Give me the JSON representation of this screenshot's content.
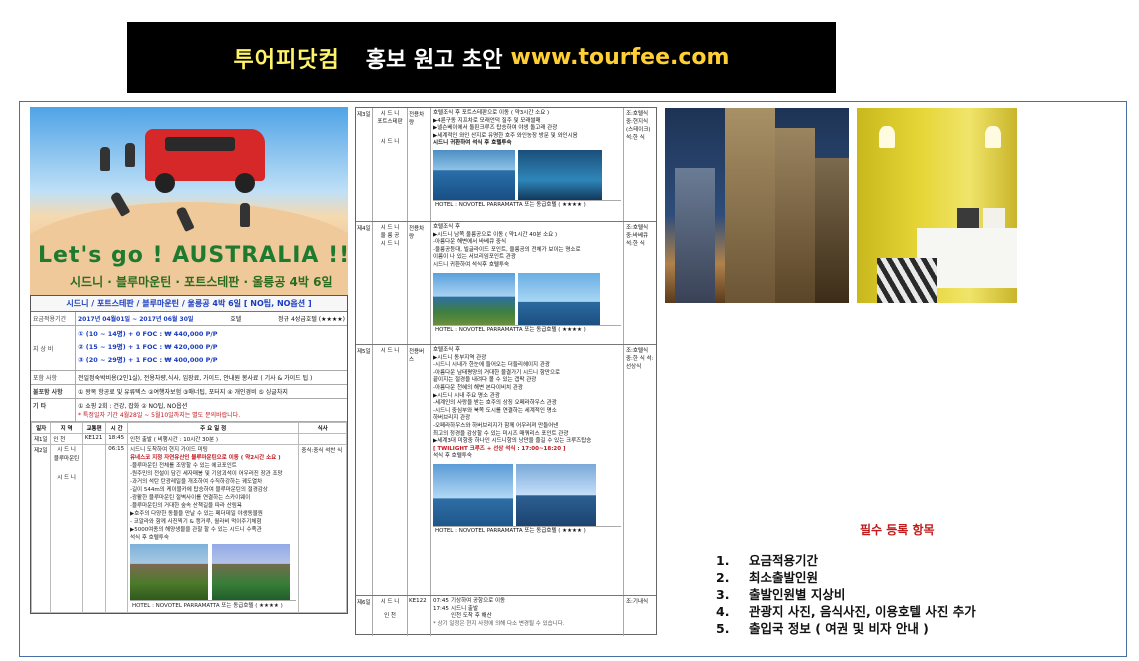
{
  "banner": {
    "title": "투어피닷컴",
    "subtitle": "홍보 원고 초안",
    "url": "www.tourfee.com"
  },
  "hero": {
    "headline": "Let's go !  AUSTRALIA !!",
    "route": "시드니 · 블루마운틴 · 포트스테판 · 울릉공 4박 6일"
  },
  "itinerary": {
    "header": "시드니 / 포트스테판 / 블루마운틴 / 울릉공 4박 6일 [ NO팁, NO옵션 ]",
    "period_label": "요금적용기간",
    "period_value": "2017년 04월01일 ~ 2017년 06월 30일",
    "hotel_label": "호텔",
    "hotel_value": "정규 4성급호텔 (★★★★)",
    "price_label": "지 상 비",
    "prices": [
      "① (10 ~ 14명) + 0 FOC : ₩ 440,000 P/P",
      "② (15 ~ 19명) + 1 FOC : ₩ 420,000 P/P",
      "③ (20 ~ 29명) + 1 FOC : ₩ 400,000 P/P"
    ],
    "include_label": "포함 사항",
    "include_value": "전일정숙박비용(2인1실), 전용차량,식사, 입장료, 가이드, 안내원 봉사료 ( 기사 & 가이드 팁 )",
    "benefit_label": "불포함 사항",
    "benefit_value": "① 왕복 항공료 및 유류텍스   ②여행자보험   ③매너팁, 포터지   ④ 개인경비   ⑤ 싱글차지",
    "etc_label": "기 타",
    "etc_value1": "① 쇼핑 2회 : 건강, 잡화   ② NO팁, NO옵션",
    "etc_value2": "* 특정일자 기간 4월28일 ~ 5월10일까지는 별도 문의바랍니다.",
    "columns": [
      "일자",
      "지 역",
      "교통편",
      "시 간",
      "주 요 일 정",
      "식사"
    ],
    "day1": {
      "day": "제1일",
      "loc": "인 천",
      "tr": "KE121",
      "time": "18:45",
      "body": "인천 출발 ( 비행시간 : 10시간 30분 )"
    },
    "day2": {
      "day": "제2일",
      "loc1": "시 드 니",
      "loc2": "블루마운틴",
      "loc3": "시 드 니",
      "time": "06:15",
      "lines": [
        "시드니 도착하여 현지 가이드 미팅",
        "유네스코 지정 자연유산인 블루마운틴으로 이동 ( 약2시간 소요 )",
        "-블루마운틴 전체를 조망할 수 있는 에코포인트",
        "-원주민의 전설이 담긴 세자매봉 및 기암괴석이 어우러진 장관 조망",
        "-과거의 석탄 탄광레일을 개조하여 수직하강하는 궤도열차",
        "-길이 544m의 케이블카에 탑승하여 블루마운틴의 절경감상",
        "-광활한 블루마운틴 절벽사이를 연결하는 스카이웨이",
        "-블루마운틴의 거대한 숲속 산책길을 따라 산림욕",
        "▶호주의 다양한 동물을 만날 수 있는 페더데일 야생동물원",
        "- 코알라와 함께 사진찍기 & 캥거루, 월라비 먹이주기체험",
        "▶5000여종의 해양생물을 관찰 할 수 있는 시드니 수족관",
        "석식 후 호텔투숙"
      ],
      "meal": "중식:중식 석찬 식",
      "hotel": "HOTEL : NOVOTEL PARRAMATTA 또는 동급호텔 ( ★★★★ )"
    },
    "day3": {
      "day": "제3일",
      "loc1": "시 드 니",
      "loc2": "포트스테판",
      "loc3": "시 드 니",
      "tr": "전용차량",
      "lines": [
        "호텔조식 후 포트스테판으로 이동 ( 약3시간 소요 )",
        "▶4륜구동 지프차로 모래언덕 질주 및 모래썰매",
        "▶넬슨베이에서 돌핀크루즈 탑승하여 야생 돌고래 관광",
        "▶세계적인 와인 산지로 유명한 호주 와인농장 방문 및 와인시음",
        "시드니 귀환하여 석식 후 호텔투숙"
      ],
      "meal": "조:호텔식 중:현지식 (스테이크) 석:한 식",
      "hotel": "HOTEL : NOVOTEL PARRAMATTA 또는 동급호텔 ( ★★★★ )"
    },
    "day4": {
      "day": "제4일",
      "loc1": "시 드 니",
      "loc2": "울 릉 공",
      "loc3": "시 드 니",
      "tr": "전용차량",
      "lines": [
        "호텔조식 후",
        "▶시드니 남쪽 울릉공으로 이동 ( 약1시간 40분 소요 )",
        "-아름다운 해변에서 바베큐 중식",
        "-울릉공등대, 빌글라이드 포인트, 울릉공의 전체가 보이는 명소로",
        "이름이 나 있는 서브리임포인트 관광",
        "시드니 귀환하여 석식후 호텔투숙"
      ],
      "meal": "조:호텔식 중:바베큐 석:한 식",
      "hotel": "HOTEL : NOVOTEL PARRAMATTA 또는 동급호텔 ( ★★★★ )"
    },
    "day5": {
      "day": "제5일",
      "loc1": "시 드 니",
      "tr": "전용버스",
      "lines": [
        "호텔조식 후",
        "▶시드니 동부지역 관광",
        "-시드니 시내가 한눈에 들어오는 더들리헤이지 관광",
        "-아름다운 남태평양의 거대한 물결가기 시드니 항만으로",
        "끝이지는 절경을 내려다 볼 수 있는 갭팍 관광",
        "-아름다운 천혜의 해변 본다이비치 관광",
        "▶시드니 시내 주요 명소 관광",
        "-세계인의 사랑을 받는 호주의 상징 오페라하우스 관광",
        "-시드니 중심부와 북쪽 도시를 연결하는 세계적인 명소",
        "하버브리지 관광",
        "-오페라하우스와 하버브리지가 함께 어우러져 만들어낸",
        "최고의 정경을 감상할 수 있는 미시즈 매쿼리스 포인트 관광",
        "▶세계3대 미항중 하나인 시드니항의 낭만을 즐길 수 있는 크루즈탑승",
        "[ TWILIGHT 크루즈 + 선상 석식 : 17:00~18:20 ]",
        "석식 후 호텔투숙"
      ],
      "meal": "조:호텔식 중:한 식 석:선상식",
      "hotel": "HOTEL : NOVOTEL PARRAMATTA 또는 동급호텔 ( ★★★★ )"
    },
    "day6": {
      "day": "제6일",
      "loc1": "시 드 니",
      "loc2": "인 천",
      "tr": "KE122",
      "time1": "07:45",
      "time2": "17:45",
      "lines": [
        "기상하여 공항으로 이동",
        "시드니 출발",
        "인천 도착 후 해산"
      ],
      "meal": "조:기내식",
      "note": "* 상기 일정은 현지 사정에 의해 다소 변경될 수 있습니다."
    }
  },
  "requirements": {
    "title": "필수 등록 항목",
    "items": [
      {
        "num": "1.",
        "text": "요금적용기간"
      },
      {
        "num": "2.",
        "text": "최소출발인원"
      },
      {
        "num": "3.",
        "text": "출발인원별 지상비"
      },
      {
        "num": "4.",
        "text": "관광지 사진, 음식사진, 이용호텔 사진 추가"
      },
      {
        "num": "5.",
        "text": "출입국 정보 ( 여권 및 비자 안내  )"
      }
    ]
  }
}
